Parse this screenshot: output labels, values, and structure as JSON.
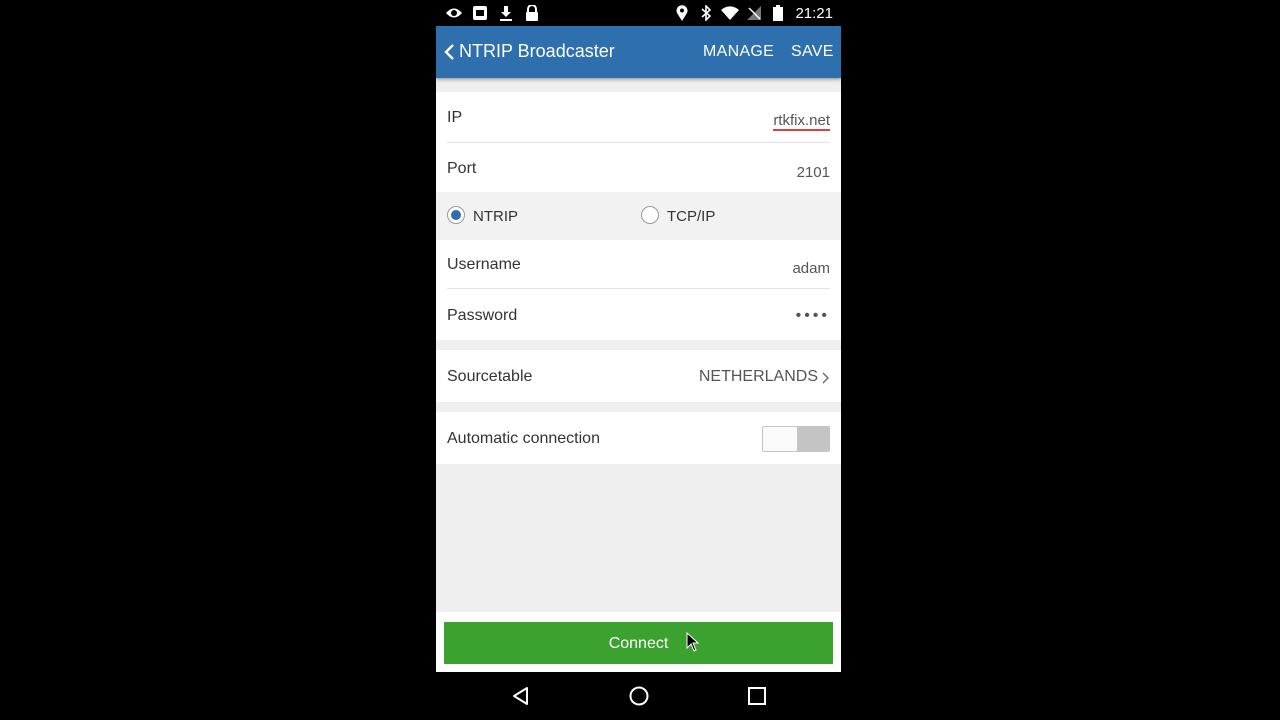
{
  "status_bar": {
    "time": "21:21",
    "left_icons": [
      "eye-icon",
      "screen-mirror-icon",
      "download-icon",
      "lock-icon"
    ],
    "right_icons": [
      "location-pin-icon",
      "bluetooth-icon",
      "wifi-icon",
      "no-signal-icon",
      "battery-icon"
    ]
  },
  "app_bar": {
    "title": "NTRIP Broadcaster",
    "manage_label": "MANAGE",
    "save_label": "SAVE",
    "color": "#2e6fad"
  },
  "form": {
    "ip": {
      "label": "IP",
      "value": "rtkfix.net"
    },
    "port": {
      "label": "Port",
      "value": "2101"
    },
    "protocol": {
      "options": [
        {
          "label": "NTRIP",
          "checked": true
        },
        {
          "label": "TCP/IP",
          "checked": false
        }
      ]
    },
    "username": {
      "label": "Username",
      "value": "adam"
    },
    "password": {
      "label": "Password",
      "value": "••••"
    },
    "sourcetable": {
      "label": "Sourcetable",
      "value": "NETHERLANDS"
    },
    "auto_connection": {
      "label": "Automatic connection",
      "enabled": false
    }
  },
  "connect": {
    "label": "Connect",
    "color": "#3ca22f"
  },
  "nav_bar": {
    "icons": [
      "back-triangle-icon",
      "home-circle-icon",
      "recents-square-icon"
    ]
  }
}
